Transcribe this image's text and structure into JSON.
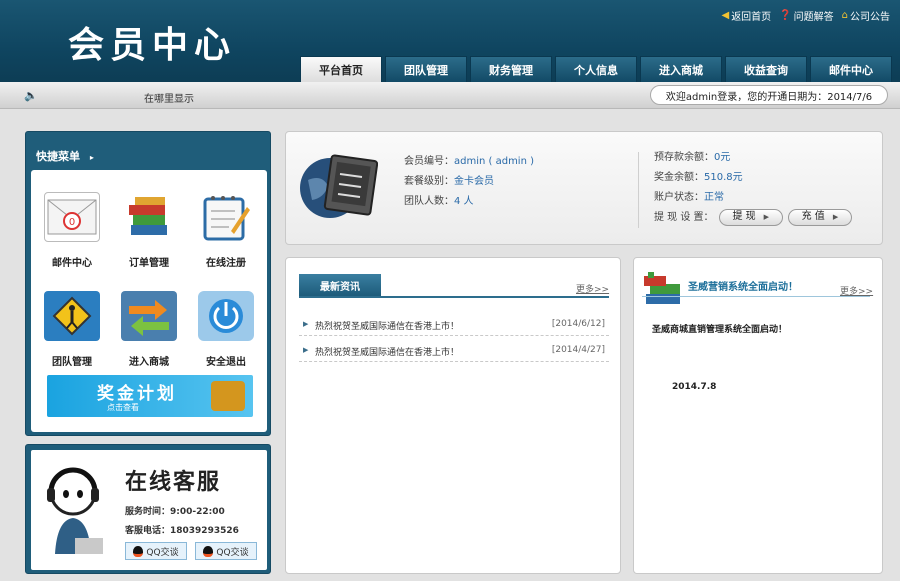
{
  "header": {
    "logo": "会员中心",
    "links": [
      {
        "icon": "speaker-icon",
        "label": "返回首页"
      },
      {
        "icon": "help-icon",
        "label": "问题解答"
      },
      {
        "icon": "home-icon",
        "label": "公司公告"
      }
    ]
  },
  "nav": {
    "tabs": [
      "平台首页",
      "团队管理",
      "财务管理",
      "个人信息",
      "进入商城",
      "收益查询",
      "邮件中心"
    ],
    "active": "平台首页"
  },
  "subbar": {
    "marquee": "在哪里显示",
    "welcome": "欢迎admin登录，您的开通日期为：2014/7/6"
  },
  "quick_menu": {
    "title": "快捷菜单",
    "items": [
      {
        "label": "邮件中心",
        "icon": "mail-icon",
        "badge": "0"
      },
      {
        "label": "订单管理",
        "icon": "books-icon"
      },
      {
        "label": "在线注册",
        "icon": "register-icon"
      },
      {
        "label": "团队管理",
        "icon": "team-sign-icon"
      },
      {
        "label": "进入商城",
        "icon": "shop-arrows-icon"
      },
      {
        "label": "安全退出",
        "icon": "power-icon"
      }
    ],
    "bonus_title": "奖金计划",
    "bonus_sub": "点击查看"
  },
  "service": {
    "title": "在线客服",
    "hours": "服务时间：9:00-22:00",
    "phone": "客服电话：18039293526",
    "qq1": "QQ交谈",
    "qq2": "QQ交谈"
  },
  "account": {
    "member_no_label": "会员编号：",
    "member_no": "admin ( admin )",
    "level_label": "套餐级别：",
    "level": "金卡会员",
    "team_label": "团队人数：",
    "team": "4 人",
    "deposit_label": "预存款余额：",
    "deposit": "0元",
    "bonus_label": "奖金余额：",
    "bonus": "510.8元",
    "status_label": "账户状态：",
    "status": "正常",
    "settings_label": "提 现 设 置：",
    "withdraw_btn": "提 现",
    "recharge_btn": "充 值"
  },
  "news": {
    "tab": "最新资讯",
    "more": "更多>>",
    "items": [
      {
        "title": "热烈祝贺圣威国际通信在香港上市！",
        "date": "[2014/6/12]"
      },
      {
        "title": "热烈祝贺圣威国际通信在香港上市！",
        "date": "[2014/4/27]"
      }
    ]
  },
  "announcement": {
    "title": "圣威营销系统全面启动！",
    "more": "更多>>",
    "text": "圣威商城直销管理系统全面启动！",
    "date": "2014.7.8"
  }
}
